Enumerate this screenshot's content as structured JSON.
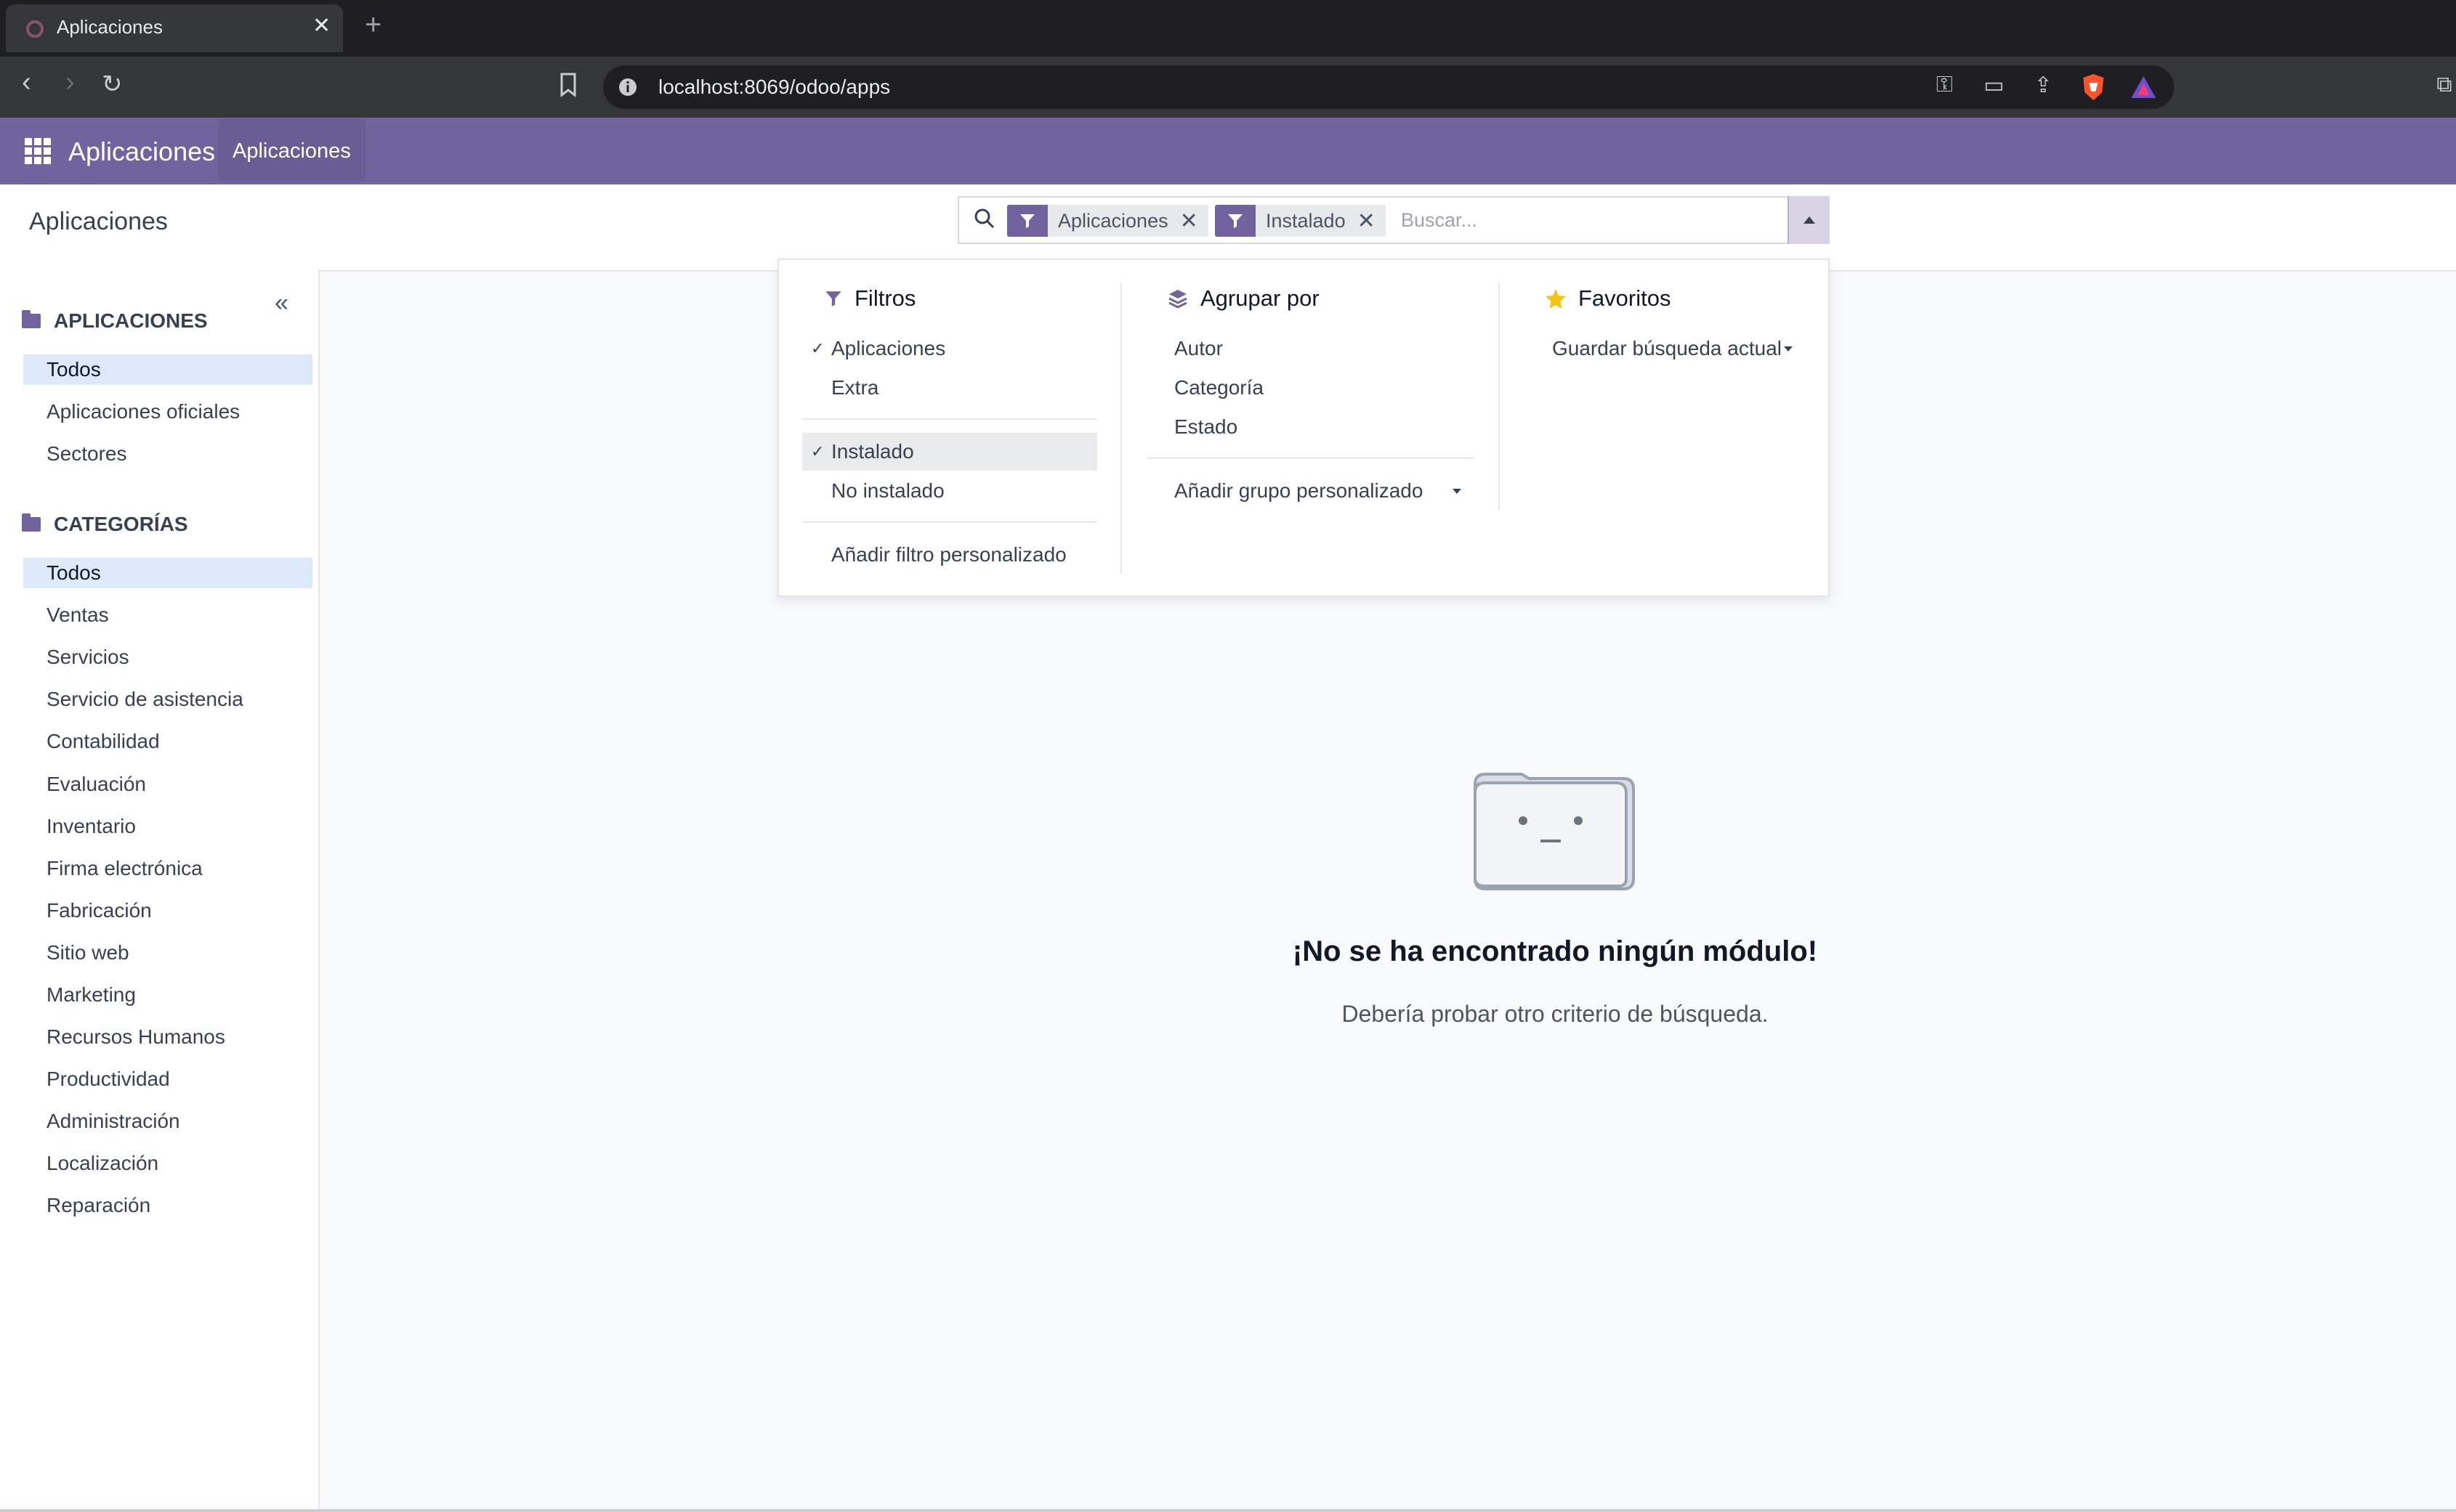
{
  "browser": {
    "tab_title": "Aplicaciones",
    "url": "localhost:8069/odoo/apps"
  },
  "navbar": {
    "brand": "Aplicaciones",
    "menu_item": "Aplicaciones"
  },
  "control_panel": {
    "breadcrumb": "Aplicaciones",
    "facets": [
      {
        "label": "Aplicaciones"
      },
      {
        "label": "Instalado"
      }
    ],
    "search_placeholder": "Buscar..."
  },
  "sidebar": {
    "sections": [
      {
        "title": "APLICACIONES",
        "items": [
          {
            "label": "Todos",
            "active": true
          },
          {
            "label": "Aplicaciones oficiales",
            "active": false
          },
          {
            "label": "Sectores",
            "active": false
          }
        ]
      },
      {
        "title": "CATEGORÍAS",
        "items": [
          {
            "label": "Todos",
            "active": true
          },
          {
            "label": "Ventas"
          },
          {
            "label": "Servicios"
          },
          {
            "label": "Servicio de asistencia"
          },
          {
            "label": "Contabilidad"
          },
          {
            "label": "Evaluación"
          },
          {
            "label": "Inventario"
          },
          {
            "label": "Firma electrónica"
          },
          {
            "label": "Fabricación"
          },
          {
            "label": "Sitio web"
          },
          {
            "label": "Marketing"
          },
          {
            "label": "Recursos Humanos"
          },
          {
            "label": "Productividad"
          },
          {
            "label": "Administración"
          },
          {
            "label": "Localización"
          },
          {
            "label": "Reparación"
          }
        ]
      }
    ]
  },
  "dropdown": {
    "filters": {
      "title": "Filtros",
      "group1": [
        {
          "label": "Aplicaciones",
          "checked": true
        },
        {
          "label": "Extra",
          "checked": false
        }
      ],
      "group2": [
        {
          "label": "Instalado",
          "checked": true
        },
        {
          "label": "No instalado",
          "checked": false
        }
      ],
      "custom": "Añadir filtro personalizado"
    },
    "group_by": {
      "title": "Agrupar por",
      "items": [
        "Autor",
        "Categoría",
        "Estado"
      ],
      "custom": "Añadir grupo personalizado"
    },
    "favorites": {
      "title": "Favoritos",
      "save": "Guardar búsqueda actual"
    }
  },
  "empty_state": {
    "title": "¡No se ha encontrado ningún módulo!",
    "subtitle": "Debería probar otro criterio de búsqueda."
  },
  "colors": {
    "brand": "#71639e",
    "star": "#f3c316",
    "active_bg": "#dbe9f8"
  }
}
